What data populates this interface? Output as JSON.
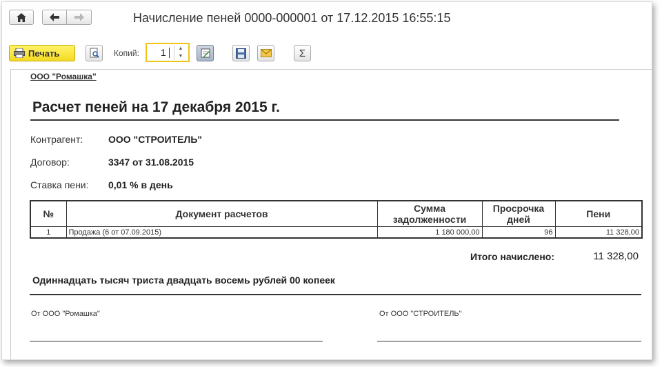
{
  "window": {
    "title": "Начисление пеней 0000-000001 от 17.12.2015 16:55:15"
  },
  "nav": {
    "home_icon": "home-icon",
    "back_icon": "arrow-left-icon",
    "forward_icon": "arrow-right-icon"
  },
  "toolbar": {
    "print_label": "Печать",
    "copies_label": "Копий:",
    "copies_value": "1",
    "icons": [
      "preview-icon",
      "edit-document-icon",
      "save-icon",
      "mail-icon",
      "sum-icon"
    ],
    "print_color": "#f7dd2a"
  },
  "document": {
    "organization": "ООО \"Ромашка\"",
    "title": "Расчет пеней на 17 декабря 2015 г.",
    "fields": {
      "counterparty_label": "Контрагент:",
      "counterparty_value": "ООО \"СТРОИТЕЛЬ\"",
      "contract_label": "Договор:",
      "contract_value": "3347 от 31.08.2015",
      "rate_label": "Ставка пени:",
      "rate_value": "0,01 % в день"
    },
    "table": {
      "headers": {
        "num": "№",
        "document": "Документ расчетов",
        "debt_line1": "Сумма",
        "debt_line2": "задолженности",
        "overdue_line1": "Просрочка",
        "overdue_line2": "дней",
        "penalty": "Пени"
      },
      "rows": [
        {
          "num": "1",
          "document": "Продажа (6 от 07.09.2015)",
          "debt": "1 180 000,00",
          "days": "96",
          "penalty": "11 328,00"
        }
      ]
    },
    "total_label": "Итого начислено:",
    "total_value": "11 328,00",
    "amount_in_words": "Одиннадцать тысяч триста двадцать восемь рублей 00 копеек",
    "signature_left": "От ООО \"Ромашка\"",
    "signature_right": "От ООО \"СТРОИТЕЛЬ\""
  }
}
